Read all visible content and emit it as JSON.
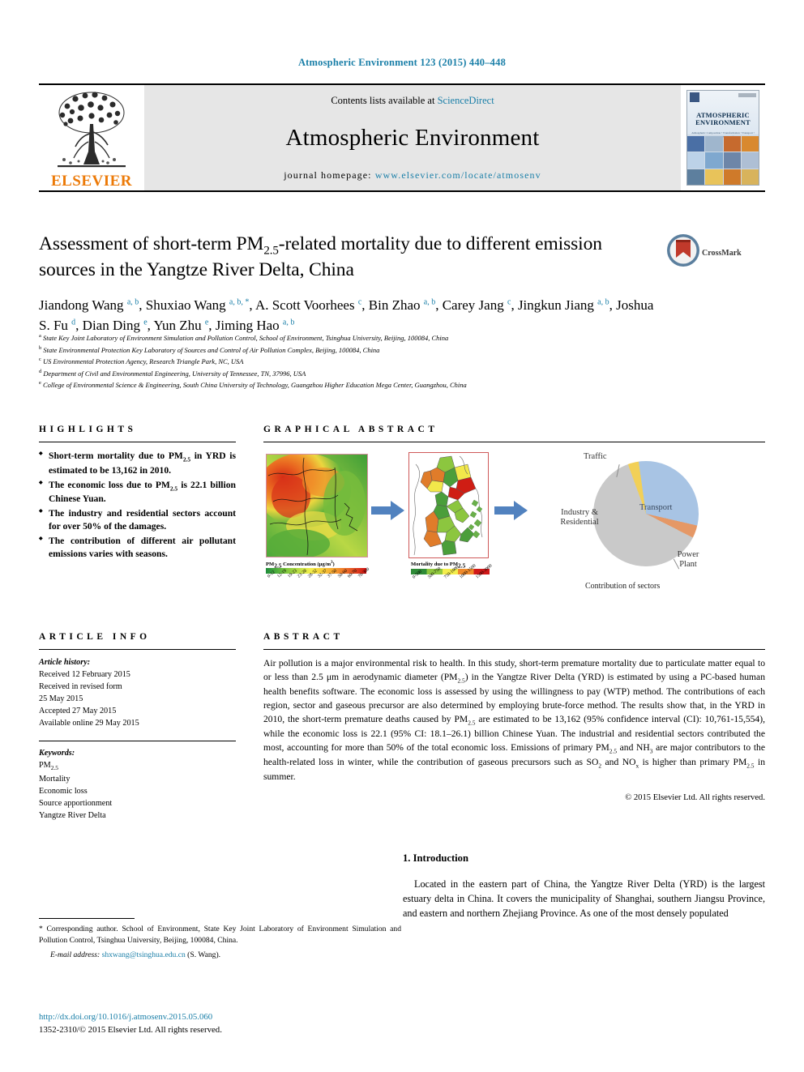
{
  "running_head": "Atmospheric Environment 123 (2015) 440–448",
  "masthead": {
    "contents_prefix": "Contents lists available at",
    "sciencedirect": "ScienceDirect",
    "journal_name": "Atmospheric Environment",
    "homepage_prefix": "journal homepage:",
    "homepage_url": "www.elsevier.com/locate/atmosenv",
    "publisher": "ELSEVIER",
    "cover_title_line1": "ATMOSPHERIC",
    "cover_title_line2": "ENVIRONMENT",
    "cover_subtitle": "Atmospheric Composition • Transformation • Transport • Deposition • Health Effects"
  },
  "article": {
    "title": "Assessment of short-term PM2.5-related mortality due to different emission sources in the Yangtze River Delta, China",
    "title_part1": "Assessment of short-term PM",
    "title_sub": "2.5",
    "title_part2": "-related mortality due to different emission sources in the Yangtze River Delta, China",
    "crossmark_label": "CrossMark"
  },
  "authors": [
    {
      "name": "Jiandong Wang",
      "marks": "a, b",
      "sep": ", "
    },
    {
      "name": "Shuxiao Wang",
      "marks": "a, b, *",
      "sep": ", "
    },
    {
      "name": "A. Scott Voorhees",
      "marks": "c",
      "sep": ", "
    },
    {
      "name": "Bin Zhao",
      "marks": "a, b",
      "sep": ", "
    },
    {
      "name": "Carey Jang",
      "marks": "c",
      "sep": ", "
    },
    {
      "name": "Jingkun Jiang",
      "marks": "a, b",
      "sep": ", "
    },
    {
      "name": "Joshua S. Fu",
      "marks": "d",
      "sep": ", "
    },
    {
      "name": "Dian Ding",
      "marks": "e",
      "sep": ", "
    },
    {
      "name": "Yun Zhu",
      "marks": "e",
      "sep": ", "
    },
    {
      "name": "Jiming Hao",
      "marks": "a, b",
      "sep": ""
    }
  ],
  "affiliations": [
    {
      "label": "a",
      "text": "State Key Joint Laboratory of Environment Simulation and Pollution Control, School of Environment, Tsinghua University, Beijing, 100084, China"
    },
    {
      "label": "b",
      "text": "State Environmental Protection Key Laboratory of Sources and Control of Air Pollution Complex, Beijing, 100084, China"
    },
    {
      "label": "c",
      "text": "US Environmental Protection Agency, Research Triangle Park, NC, USA"
    },
    {
      "label": "d",
      "text": "Department of Civil and Environmental Engineering, University of Tennessee, TN, 37996, USA"
    },
    {
      "label": "e",
      "text": "College of Environmental Science & Engineering, South China University of Technology, Guangzhou Higher Education Mega Center, Guangzhou, China"
    }
  ],
  "highlights": {
    "heading": "HIGHLIGHTS",
    "items": [
      "Short-term mortality due to PM2.5 in YRD is estimated to be 13,162 in 2010.",
      "The economic loss due to PM2.5 is 22.1 billion Chinese Yuan.",
      "The industry and residential sectors account for over 50% of the damages.",
      "The contribution of different air pollutant emissions varies with seasons."
    ]
  },
  "graphical_abstract": {
    "heading": "GRAPHICAL ABSTRACT",
    "map1_caption": "PM2.5 Concentration (μg/m3)",
    "map1_ticks": [
      "0-12",
      "12-19",
      "19-23",
      "23-28",
      "28-32",
      "32-37",
      "37-50",
      "50-60",
      "60-70",
      "70-300"
    ],
    "map2_caption": "Mortality due to PM2.5",
    "map2_ticks": [
      "0-500",
      "500-750",
      "750-1000",
      "1000-1500",
      "1500-3000"
    ],
    "pie_caption": "Contribution of sectors",
    "pie_labels": {
      "traffic": "Traffic",
      "transport": "Transport",
      "industry": "Industry & Residential",
      "power": "Power Plant"
    }
  },
  "chart_data": {
    "type": "pie",
    "title": "Contribution of sectors",
    "categories": [
      "Transport",
      "Power Plant",
      "Industry & Residential",
      "Traffic"
    ],
    "values": [
      28.6,
      3.9,
      61.9,
      3.3
    ],
    "colors": [
      "#a8c4e4",
      "#e59866",
      "#c9c9c9",
      "#f2d057"
    ],
    "legend": "labels on slices",
    "units": "percent of sector contribution"
  },
  "article_info": {
    "heading": "ARTICLE INFO",
    "history_label": "Article history:",
    "history": [
      "Received 12 February 2015",
      "Received in revised form",
      "25 May 2015",
      "Accepted 27 May 2015",
      "Available online 29 May 2015"
    ],
    "keywords_label": "Keywords:",
    "keywords": [
      "PM2.5",
      "Mortality",
      "Economic loss",
      "Source apportionment",
      "Yangtze River Delta"
    ]
  },
  "abstract": {
    "heading": "ABSTRACT",
    "text": "Air pollution is a major environmental risk to health. In this study, short-term premature mortality due to particulate matter equal to or less than 2.5 μm in aerodynamic diameter (PM2.5) in the Yangtze River Delta (YRD) is estimated by using a PC-based human health benefits software. The economic loss is assessed by using the willingness to pay (WTP) method. The contributions of each region, sector and gaseous precursor are also determined by employing brute-force method. The results show that, in the YRD in 2010, the short-term premature deaths caused by PM2.5 are estimated to be 13,162 (95% confidence interval (CI): 10,761-15,554), while the economic loss is 22.1 (95% CI: 18.1–26.1) billion Chinese Yuan. The industrial and residential sectors contributed the most, accounting for more than 50% of the total economic loss. Emissions of primary PM2.5 and NH3 are major contributors to the health-related loss in winter, while the contribution of gaseous precursors such as SO2 and NOx is higher than primary PM2.5 in summer.",
    "copyright": "© 2015 Elsevier Ltd. All rights reserved."
  },
  "introduction": {
    "heading": "1. Introduction",
    "paragraph": "Located in the eastern part of China, the Yangtze River Delta (YRD) is the largest estuary delta in China. It covers the municipality of Shanghai, southern Jiangsu Province, and eastern and northern Zhejiang Province. As one of the most densely populated"
  },
  "footnote": {
    "corresponding": "* Corresponding author. School of Environment, State Key Joint Laboratory of Environment Simulation and Pollution Control, Tsinghua University, Beijing, 100084, China.",
    "email_label": "E-mail address:",
    "email": "shxwang@tsinghua.edu.cn",
    "email_suffix": "(S. Wang).",
    "doi": "http://dx.doi.org/10.1016/j.atmosenv.2015.05.060",
    "issn": "1352-2310/© 2015 Elsevier Ltd. All rights reserved."
  }
}
